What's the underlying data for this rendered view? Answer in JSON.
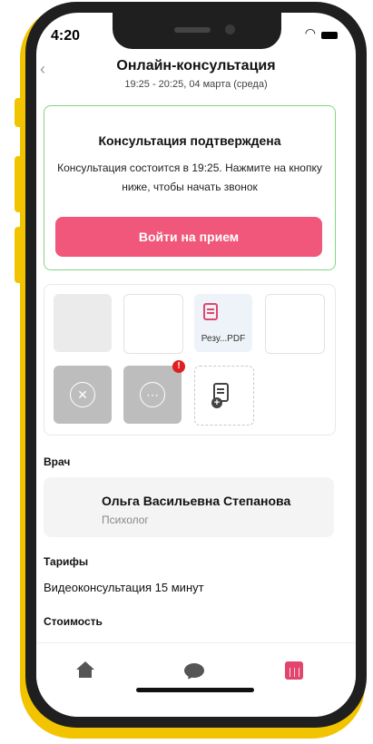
{
  "status_bar": {
    "time": "4:20"
  },
  "header": {
    "title": "Онлайн-консультация",
    "subtitle": "19:25 - 20:25, 04 марта (среда)"
  },
  "confirmation": {
    "title": "Консультация подтверждена",
    "text": "Консультация состоится в 19:25. Нажмите на кнопку ниже, чтобы начать звонок",
    "button_label": "Войти на прием",
    "border_color": "#7fd67f",
    "button_color": "#f0577a"
  },
  "attachments": {
    "files": [
      {
        "kind": "placeholder"
      },
      {
        "kind": "placeholder"
      },
      {
        "kind": "pdf",
        "label": "Резу...PDF",
        "icon": "document-icon"
      },
      {
        "kind": "placeholder"
      }
    ],
    "actions": [
      {
        "icon": "cancel-circle-icon"
      },
      {
        "icon": "more-circle-icon",
        "badge": "!"
      },
      {
        "icon": "add-file-icon"
      }
    ]
  },
  "doctor": {
    "section_label": "Врач",
    "name": "Ольга Васильевна Степанова",
    "role": "Психолог"
  },
  "tariff": {
    "section_label": "Тарифы",
    "value": "Видеоконсультация 15 минут"
  },
  "cost": {
    "section_label": "Стоимость"
  },
  "tabbar": {
    "tabs": [
      {
        "icon": "home-icon",
        "active": false
      },
      {
        "icon": "chat-icon",
        "active": false
      },
      {
        "icon": "calendar-icon",
        "active": true
      }
    ],
    "active_color": "#e2456e"
  }
}
